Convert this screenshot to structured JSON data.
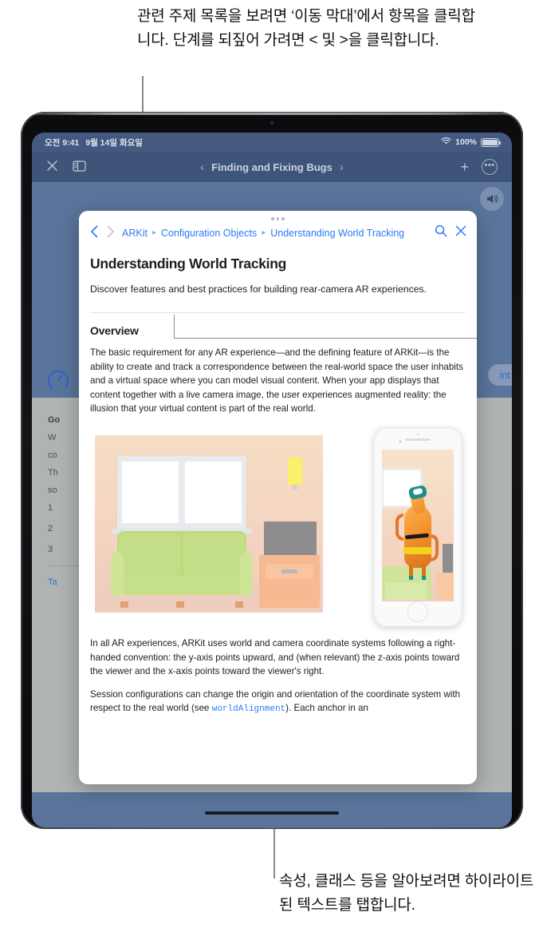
{
  "callouts": {
    "top": "관련 주제 목록을 보려면 ‘이동 막대’에서 항목을 클릭합니다. 단계를 되짚어 가려면 < 및 >을 클릭합니다.",
    "bottom": "속성, 클래스 등을 알아보려면 하이라이트된 텍스트를 탭합니다."
  },
  "device": {
    "statusbar": {
      "time": "오전 9:41",
      "date": "9월 14일 화요일",
      "battery_percent": "100%",
      "wifi_icon": "wifi-icon",
      "battery_icon": "battery-icon"
    },
    "navbar": {
      "close_icon": "close-icon",
      "sidebar_icon": "sidebar-toggle-icon",
      "back_chevron": "‹",
      "title": "Finding and Fixing Bugs",
      "forward_chevron": "›",
      "add_icon": "+",
      "more_icon": "more-icon"
    },
    "floating": {
      "speaker_icon": "speaker-icon",
      "hint_label": "int",
      "gauge_icon": "progress-gauge-icon"
    },
    "background_document": {
      "heading": "Go",
      "lines": [
        "W",
        "co",
        "Th",
        "so"
      ],
      "numbers": [
        "1",
        "2",
        "3"
      ],
      "link": "Ta"
    }
  },
  "popover": {
    "grabber_icon": "grabber-handle-icon",
    "nav": {
      "back_icon": "chevron-left-icon",
      "forward_icon": "chevron-right-icon",
      "search_icon": "search-icon",
      "close_icon": "close-icon"
    },
    "breadcrumbs": [
      "ARKit",
      "Configuration Objects",
      "Understanding World Tracking"
    ],
    "breadcrumb_separator": "▸",
    "article": {
      "title": "Understanding World Tracking",
      "lede": "Discover features and best practices for building rear-camera AR experiences.",
      "section_heading": "Overview",
      "paragraph1": "The basic requirement for any AR experience—and the defining feature of ARKit—is the ability to create and track a correspondence between the real-world space the user inhabits and a virtual space where you can model visual content. When your app displays that content together with a live camera image, the user experiences augmented reality: the illusion that your virtual content is part of the real world.",
      "figure_alt": "living-room-ar-illustration",
      "paragraph2": "In all AR experiences, ARKit uses world and camera coordinate systems following a right-handed convention: the y-axis points upward, and (when relevant) the z-axis points toward the viewer and the x-axis points toward the viewer's right.",
      "paragraph3_before": "Session configurations can change the origin and orientation of the coordinate system with respect to the real world (see ",
      "paragraph3_code": "worldAlignment",
      "paragraph3_after": "). Each anchor in an"
    }
  },
  "colors": {
    "accent_blue": "#2a7bf6",
    "navbar_blue": "#3f5479",
    "statusbar_blue": "#44597f",
    "callout_gray": "#8a8a8a",
    "text_dark": "#1d1d1f"
  }
}
